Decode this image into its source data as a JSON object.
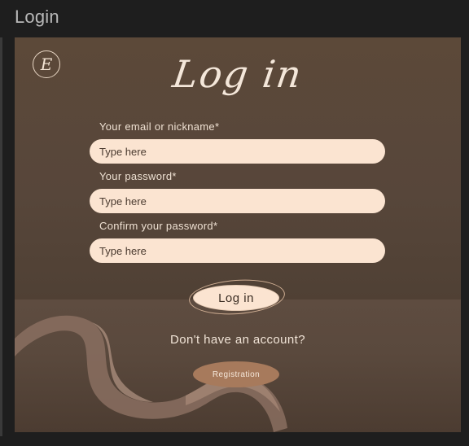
{
  "window": {
    "title": "Login"
  },
  "logo": {
    "letter": "E"
  },
  "form": {
    "heading": "Log in",
    "email_label": "Your email or nickname*",
    "email_placeholder": "Type here",
    "password_label": "Your password*",
    "password_placeholder": "Type here",
    "confirm_label": "Confirm your password*",
    "confirm_placeholder": "Type here",
    "login_button": "Log in"
  },
  "footer": {
    "prompt": "Don't have an account?",
    "register_button": "Registration"
  },
  "colors": {
    "background": "#574639",
    "input_fill": "#fbe4d1",
    "accent_button": "#a77a5c"
  }
}
